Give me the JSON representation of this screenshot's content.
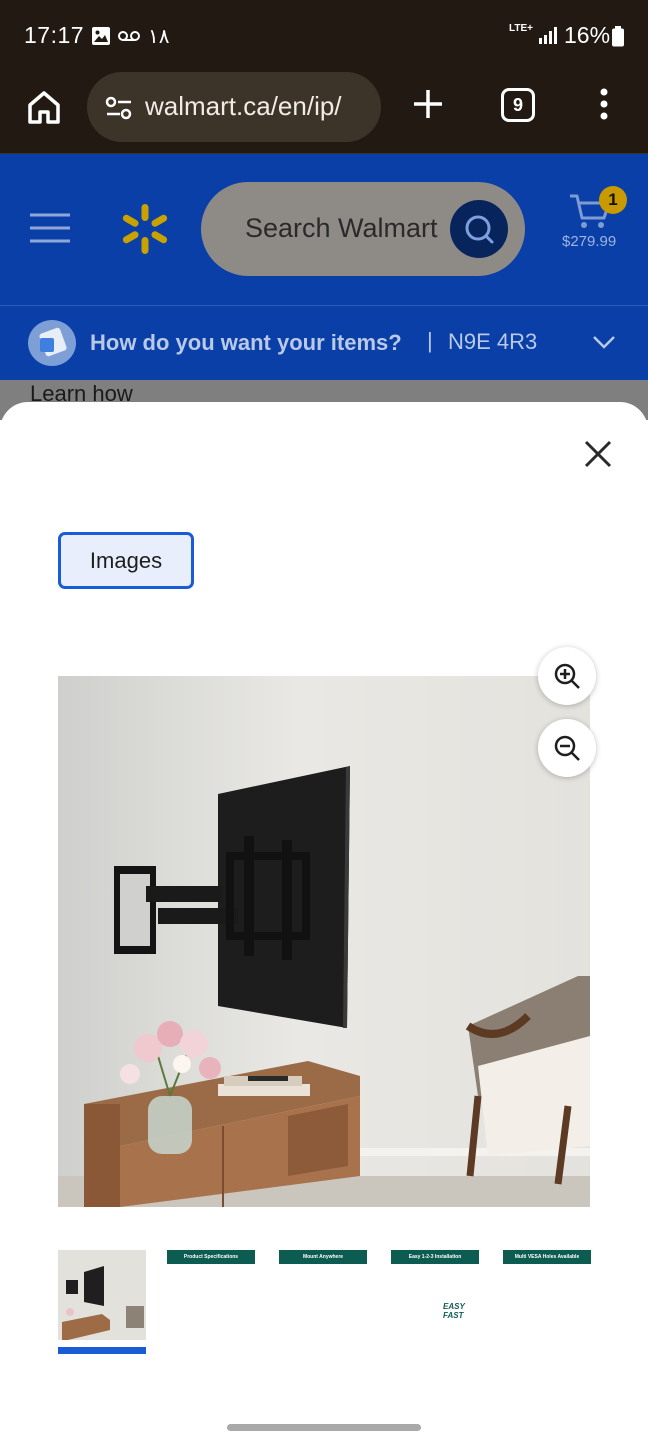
{
  "status_bar": {
    "time": "17:17",
    "notif_count": "١٨",
    "network": "LTE+",
    "battery": "16%",
    "icons": [
      "image-icon",
      "voicemail-icon",
      "signal-icon",
      "battery-icon"
    ]
  },
  "browser": {
    "url": "walmart.ca/en/ip/",
    "tab_count": "9",
    "icons": [
      "home-icon",
      "tune-icon",
      "plus-icon",
      "more-vert-icon"
    ]
  },
  "walmart_header": {
    "search_placeholder": "Search Walmart",
    "cart_count": "1",
    "cart_total": "$279.99",
    "brand_color": "#0a3fa8",
    "spark_color": "#f2b600"
  },
  "delivery": {
    "question": "How do you want your items?",
    "separator": "|",
    "postal_code": "N9E 4R3"
  },
  "background_text": "Learn how",
  "modal": {
    "tab_label": "Images",
    "thumbnails": [
      {
        "kind": "photo",
        "header": ""
      },
      {
        "kind": "spec",
        "header": "Product Specifications"
      },
      {
        "kind": "spec",
        "header": "Mount Anywhere"
      },
      {
        "kind": "spec",
        "header": "Easy 1-2-3 Installation",
        "overlay": "EASY FAST"
      },
      {
        "kind": "spec",
        "header": "Multi VESA Holes Available"
      }
    ],
    "active_thumbnail": 0,
    "accent_color": "#1a5bd6"
  }
}
